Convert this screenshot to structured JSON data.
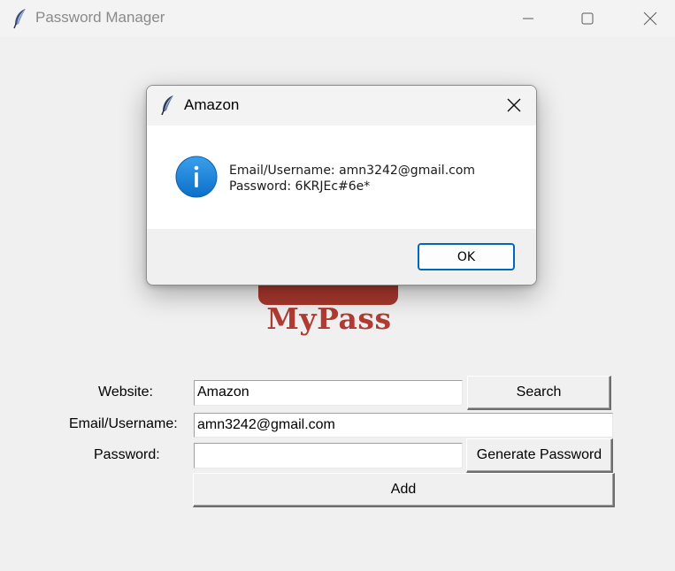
{
  "window": {
    "title": "Password Manager"
  },
  "logo": {
    "text": "MyPass",
    "color": "#b13b32"
  },
  "form": {
    "website_label": "Website:",
    "website_value": "Amazon",
    "email_label": "Email/Username:",
    "email_value": "amn3242@gmail.com",
    "password_label": "Password:",
    "password_value": "",
    "search_label": "Search",
    "generate_label": "Generate Password",
    "add_label": "Add"
  },
  "dialog": {
    "title": "Amazon",
    "icon": "info-icon",
    "line1": "Email/Username: amn3242@gmail.com",
    "line2": "Password: 6KRJEc#6e*",
    "ok_label": "OK",
    "accent": "#0067c0"
  }
}
